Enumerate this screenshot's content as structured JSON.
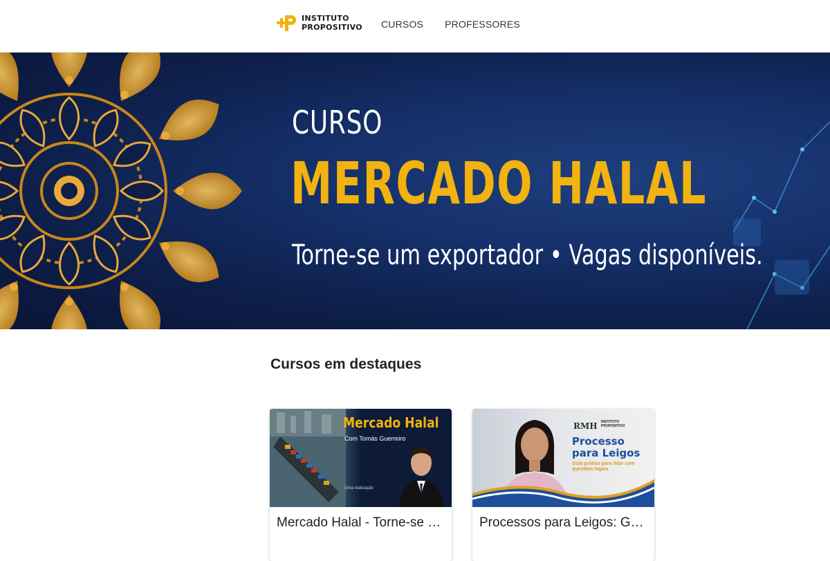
{
  "header": {
    "logo_line1": "INSTITUTO",
    "logo_line2": "PROPOSITIVO",
    "nav": [
      {
        "label": "CURSOS"
      },
      {
        "label": "PROFESSORES"
      }
    ]
  },
  "hero": {
    "line1": "CURSO",
    "line2": "MERCADO HALAL",
    "line3": "Torne-se um exportador • Vagas disponíveis."
  },
  "featured": {
    "title": "Cursos em destaques",
    "courses": [
      {
        "title": "Mercado Halal - Torne-se um exportador",
        "image_title": "Mercado Halal",
        "image_subtitle": "Com Tomás Guerreiro",
        "image_note": "Uma realização"
      },
      {
        "title": "Processos para Leigos: Guia prático para lidar com questões legais",
        "image_brand": "RMH",
        "image_logo_line1": "INSTITUTO",
        "image_logo_line2": "PROPOSITIVO",
        "image_title_line1": "Processo",
        "image_title_line2": "para Leigos",
        "image_subtitle": "Guia prático para lidar com questões legais"
      }
    ]
  },
  "colors": {
    "accent_gold": "#f2b20f",
    "hero_navy": "#0d1e48",
    "course_blue": "#1d4f9b"
  }
}
